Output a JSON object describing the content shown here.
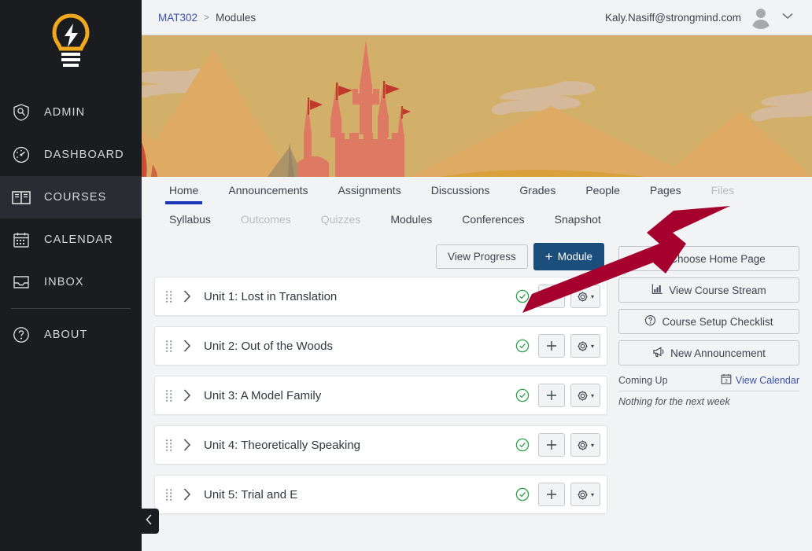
{
  "colors": {
    "nav_bg": "#1b1c20",
    "nav_active_bg": "#2a2c33",
    "brand_yellow": "#f0a81e",
    "page_bg": "#f2f3f4",
    "link_blue": "#3a52a8",
    "tab_underline": "#1d36b5",
    "primary_button": "#1c4e7c",
    "arrow_crimson": "#a6002e",
    "check_green": "#2ea24a",
    "banner_sky": "#d3b06a",
    "banner_mountain": "#deaa64",
    "banner_castle": "#de7a63"
  },
  "globalnav": {
    "logo_name": "lightbulb-logo",
    "items": [
      {
        "label": "ADMIN",
        "icon": "shield-icon",
        "active": false
      },
      {
        "label": "DASHBOARD",
        "icon": "speedometer-icon",
        "active": false
      },
      {
        "label": "COURSES",
        "icon": "book-icon",
        "active": true
      },
      {
        "label": "CALENDAR",
        "icon": "calendar-icon",
        "active": false
      },
      {
        "label": "INBOX",
        "icon": "inbox-icon",
        "active": false
      },
      {
        "label": "ABOUT",
        "icon": "question-circle-icon",
        "active": false
      }
    ],
    "collapse_icon": "chevron-left-icon"
  },
  "topbar": {
    "breadcrumb_course": "MAT302",
    "breadcrumb_separator": ">",
    "breadcrumb_current": "Modules",
    "username": "Kaly.Nasiff@strongmind.com",
    "avatar_icon": "user-avatar-icon",
    "chevron_icon": "chevron-down-icon"
  },
  "banner": {
    "alt": "course-banner-castle-mountains"
  },
  "coursenav": {
    "row1": [
      {
        "label": "Home",
        "state": "active"
      },
      {
        "label": "Announcements",
        "state": "normal"
      },
      {
        "label": "Assignments",
        "state": "normal"
      },
      {
        "label": "Discussions",
        "state": "normal"
      },
      {
        "label": "Grades",
        "state": "normal"
      },
      {
        "label": "People",
        "state": "normal"
      },
      {
        "label": "Pages",
        "state": "normal"
      },
      {
        "label": "Files",
        "state": "dim"
      }
    ],
    "row2": [
      {
        "label": "Syllabus",
        "state": "normal"
      },
      {
        "label": "Outcomes",
        "state": "dim"
      },
      {
        "label": "Quizzes",
        "state": "dim"
      },
      {
        "label": "Modules",
        "state": "normal"
      },
      {
        "label": "Conferences",
        "state": "normal"
      },
      {
        "label": "Snapshot",
        "state": "normal"
      }
    ]
  },
  "toolbar": {
    "view_progress_label": "View Progress",
    "add_module_plus": "+",
    "add_module_label": "Module"
  },
  "modules": [
    {
      "title": "Unit 1: Lost in Translation",
      "published": true
    },
    {
      "title": "Unit 2: Out of the Woods",
      "published": true
    },
    {
      "title": "Unit 3: A Model Family",
      "published": true
    },
    {
      "title": "Unit 4: Theoretically Speaking",
      "published": true
    },
    {
      "title": "Unit 5: Trial and E",
      "published": true
    }
  ],
  "module_icons": {
    "drag_handle": "drag-handle-icon",
    "expand": "chevron-right-icon",
    "published": "check-circle-icon",
    "add": "plus-icon",
    "settings": "gear-icon",
    "caret": "caret-down-icon"
  },
  "rail": {
    "buttons": [
      {
        "label": "Choose Home Page",
        "icon": "target-icon"
      },
      {
        "label": "View Course Stream",
        "icon": "chart-icon"
      },
      {
        "label": "Course Setup Checklist",
        "icon": "question-circle-icon"
      },
      {
        "label": "New Announcement",
        "icon": "megaphone-icon"
      }
    ],
    "coming_up_label": "Coming Up",
    "view_calendar_label": "View Calendar",
    "calendar_icon_day": "3",
    "empty_text": "Nothing for the next week"
  },
  "annotation": {
    "arrow_name": "red-pointer-arrow"
  }
}
